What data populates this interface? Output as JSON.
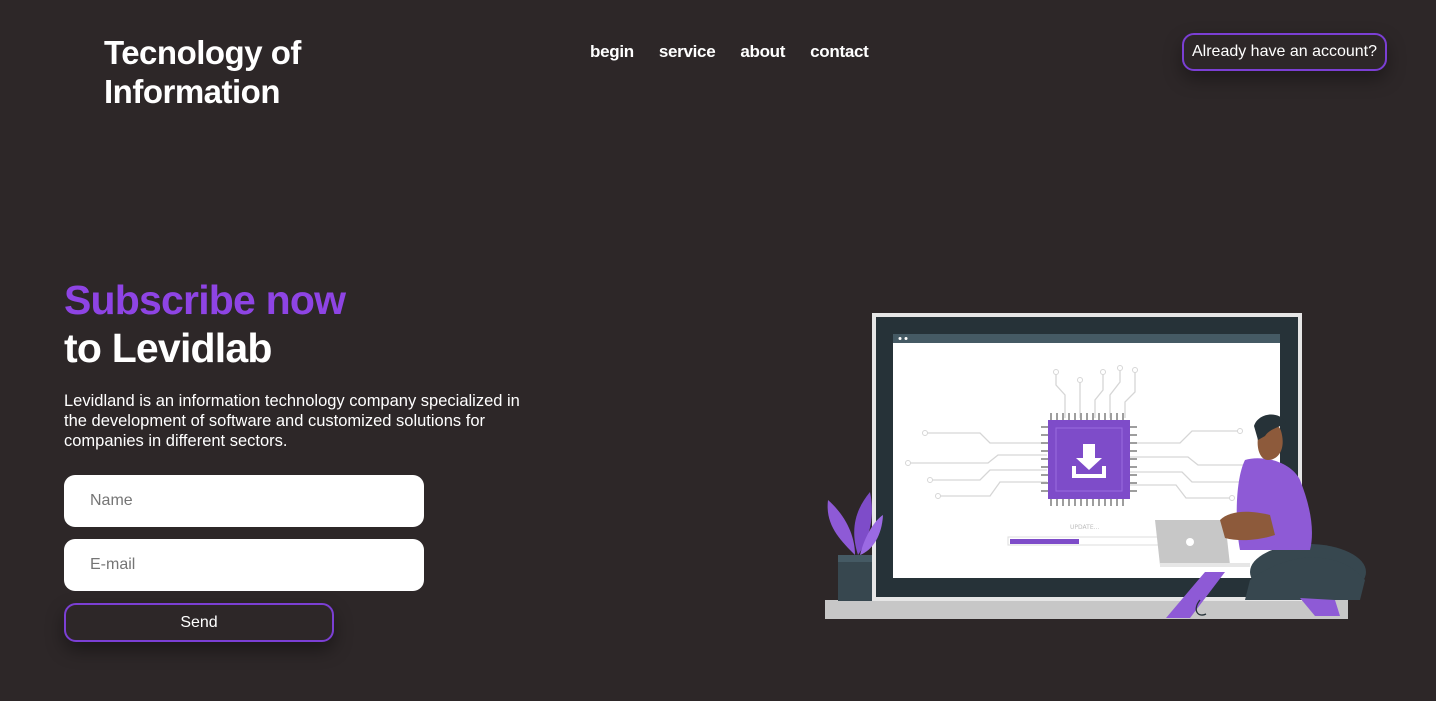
{
  "header": {
    "brand": "Tecnology of Information",
    "nav": [
      "begin",
      "service",
      "about",
      "contact"
    ],
    "account_button": "Already have an account?"
  },
  "hero": {
    "title_accent": "Subscribe now",
    "title_rest": "to Levidlab",
    "description": "Levidland is an information technology company specialized in the development of software and customized solutions for companies in different sectors."
  },
  "form": {
    "name_placeholder": "Name",
    "name_value": "",
    "email_placeholder": "E-mail",
    "email_value": "",
    "send_label": "Send"
  },
  "illustration": {
    "status_text": "UPDATE...",
    "progress": 0.45,
    "icons": [
      "download-chip-icon",
      "plant-icon",
      "laptop-icon",
      "person-figure"
    ]
  },
  "colors": {
    "background": "#2d2728",
    "accent": "#8e44e4",
    "button_border": "#7b3fd4",
    "text": "#ffffff"
  }
}
